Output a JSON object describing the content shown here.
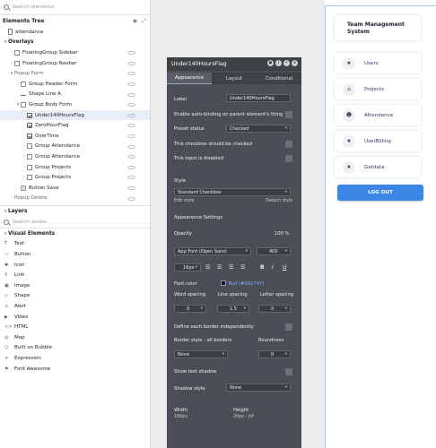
{
  "left": {
    "search_placeholder": "Search elements",
    "tree_title": "Elements Tree",
    "tree": [
      {
        "label": "attendance",
        "indent": 0,
        "icon": "page",
        "chev": "",
        "type": ""
      },
      {
        "label": "Overlays",
        "indent": 0,
        "icon": "",
        "chev": "▾",
        "type": "hdr"
      },
      {
        "label": "FloatingGroup Sidebar",
        "indent": 1,
        "icon": "dash",
        "chev": "›",
        "type": ""
      },
      {
        "label": "FloatingGroup Navbar",
        "indent": 1,
        "icon": "dash",
        "chev": "›",
        "type": ""
      },
      {
        "label": "Popup Form",
        "indent": 1,
        "icon": "",
        "chev": "▾",
        "type": "dim"
      },
      {
        "label": "Group Header Form",
        "indent": 2,
        "icon": "dash",
        "chev": "›",
        "type": ""
      },
      {
        "label": "Shape Line A",
        "indent": 2,
        "icon": "line",
        "chev": "",
        "type": ""
      },
      {
        "label": "Group Body Form",
        "indent": 2,
        "icon": "dash",
        "chev": "▾",
        "type": ""
      },
      {
        "label": "Under140HoursFlag",
        "indent": 3,
        "icon": "check",
        "chev": "",
        "type": "sel"
      },
      {
        "label": "ZeroHourFlag",
        "indent": 3,
        "icon": "check",
        "chev": "",
        "type": ""
      },
      {
        "label": "OverTime",
        "indent": 3,
        "icon": "check",
        "chev": "",
        "type": ""
      },
      {
        "label": "Group Attendance",
        "indent": 3,
        "icon": "dash",
        "chev": "›",
        "type": ""
      },
      {
        "label": "Group Attendance",
        "indent": 3,
        "icon": "dash",
        "chev": "›",
        "type": ""
      },
      {
        "label": "Group Projects",
        "indent": 3,
        "icon": "dash",
        "chev": "›",
        "type": ""
      },
      {
        "label": "Group Projects",
        "indent": 3,
        "icon": "dash",
        "chev": "›",
        "type": ""
      },
      {
        "label": "Button Save",
        "indent": 2,
        "icon": "btn",
        "chev": "",
        "type": ""
      },
      {
        "label": "Popup Delete",
        "indent": 1,
        "icon": "",
        "chev": "›",
        "type": "dim"
      }
    ],
    "layers_label": "Layers",
    "assets_placeholder": "Search assets",
    "visual_label": "Visual Elements",
    "visual": [
      "Text",
      "Button",
      "Icon",
      "Link",
      "Image",
      "Shape",
      "Alert",
      "Video",
      "HTML",
      "Map",
      "Built on Bubble",
      "Expression",
      "Font Awesome"
    ]
  },
  "panel": {
    "title": "Under140HoursFlag",
    "tabs": [
      "Appearance",
      "Layout",
      "Conditional"
    ],
    "label_label": "Label",
    "label_value": "Under140HoursFlag",
    "autobind": "Enable auto-binding on parent element's thing",
    "preset_label": "Preset status",
    "preset_value": "Checked",
    "should_check": "This checkbox should be checked",
    "disabled": "This input is disabled",
    "style_label": "Style",
    "style_value": "Standard Checkbox",
    "edit_style": "Edit style",
    "detach_style": "Detach style",
    "appearance_settings": "Appearance Settings",
    "opacity_label": "Opacity",
    "opacity_value": "100 %",
    "font_value": "App Font (Open Sans)",
    "weight_value": "400",
    "size_value": "16px",
    "font_color_label": "Font color",
    "font_color_value": "Text (#091747)",
    "word_spacing": "Word spacing",
    "line_spacing": "Line spacing",
    "letter_spacing": "Letter spacing",
    "word_val": "0",
    "line_val": "1.5",
    "letter_val": "0",
    "define_border": "Define each border independently",
    "border_style": "Border style - all borders",
    "roundness": "Roundness",
    "border_val": "None",
    "round_val": "0",
    "shadow_text": "Show text shadow",
    "shadow_style": "Shadow style",
    "shadow_val": "None",
    "width_label": "Width",
    "width_val": "180px",
    "height_label": "Height",
    "height_val": "20px - inf"
  },
  "right": {
    "title_line1": "Team Management",
    "title_line2": "System",
    "menu": [
      {
        "label": "Users",
        "icon": "★"
      },
      {
        "label": "Projects",
        "icon": "⌂"
      },
      {
        "label": "Attendance",
        "icon": "☻"
      },
      {
        "label": "UserBilling",
        "icon": "★"
      },
      {
        "label": "Getdata",
        "icon": "★"
      }
    ],
    "logout": "LOG OUT"
  }
}
